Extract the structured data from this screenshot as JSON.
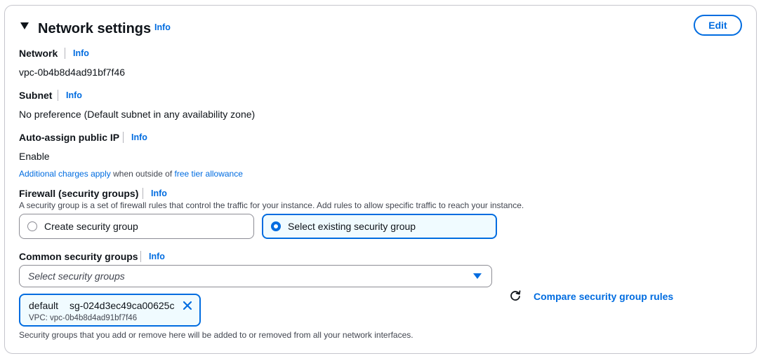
{
  "header": {
    "title": "Network settings",
    "info": "Info",
    "edit_label": "Edit"
  },
  "network": {
    "label": "Network",
    "info": "Info",
    "value": "vpc-0b4b8d4ad91bf7f46"
  },
  "subnet": {
    "label": "Subnet",
    "info": "Info",
    "value": "No preference (Default subnet in any availability zone)"
  },
  "auto_assign": {
    "label": "Auto-assign public IP",
    "info": "Info",
    "value": "Enable",
    "charges_link": "Additional charges apply",
    "charges_mid": " when outside of ",
    "free_tier_link": "free tier allowance"
  },
  "firewall": {
    "label": "Firewall (security groups)",
    "info": "Info",
    "description": "A security group is a set of firewall rules that control the traffic for your instance. Add rules to allow specific traffic to reach your instance.",
    "options": [
      {
        "label": "Create security group",
        "selected": false
      },
      {
        "label": "Select existing security group",
        "selected": true
      }
    ]
  },
  "common_groups": {
    "label": "Common security groups",
    "info": "Info",
    "placeholder": "Select security groups",
    "token": {
      "name": "default",
      "id": "sg-024d3ec49ca00625c",
      "vpc": "VPC: vpc-0b4b8d4ad91bf7f46"
    },
    "compare_label": "Compare security group rules",
    "footer": "Security groups that you add or remove here will be added to or removed from all your network interfaces."
  },
  "colors": {
    "accent": "#006ce0",
    "selected_bg": "#f0fbff",
    "border": "#c6c6cd",
    "text": "#0f141a"
  },
  "icons": [
    "caret-down-icon",
    "radio-icon",
    "dropdown-caret-icon",
    "close-icon",
    "refresh-icon"
  ]
}
